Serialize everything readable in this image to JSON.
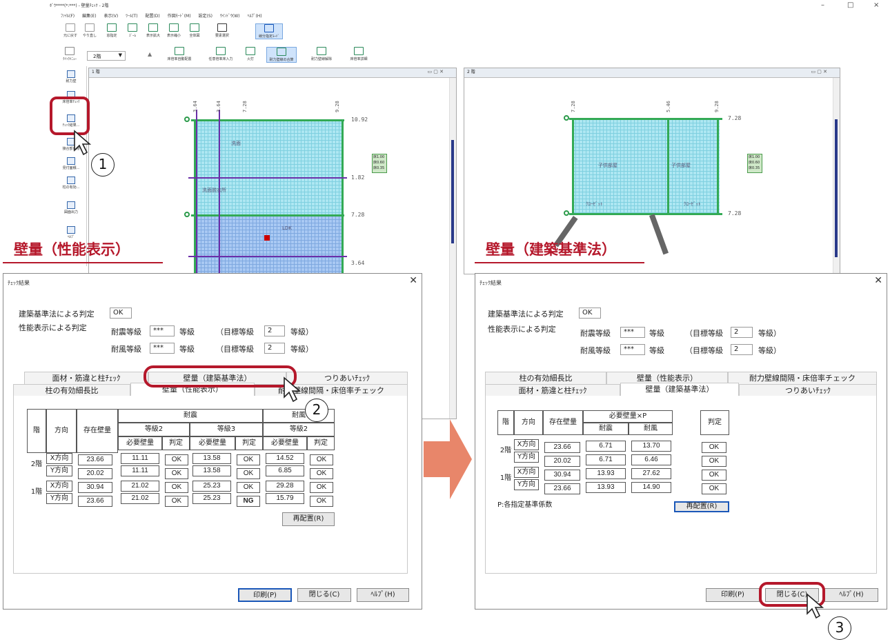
{
  "app": {
    "title": "ﾎﾞｳ****(*:***) - 壁量ﾁｪｯｸ - 2階",
    "menu": [
      "ﾌｧｲﾙ(F)",
      "編集(E)",
      "表示(V)",
      "ﾂｰﾙ(T)",
      "配置(D)",
      "作図ﾓｰﾄﾞ(M)",
      "設定(S)",
      "ｳｲﾝﾄﾞｳ(W)",
      "ﾍﾙﾌﾟ(H)"
    ],
    "toolbar": [
      "元に戻す",
      "やり直し",
      "窓指定",
      "ｽﾞｰﾑ",
      "表示拡大",
      "表示縮小",
      "全体図",
      "要素選択",
      "線分指定ﾓｰﾄﾞ"
    ],
    "toolbar2": [
      "床倍率自動配置",
      "任意倍率床入力",
      "火打",
      "耐力壁線の合算",
      "耐力壁線解除",
      "床倍率詳細"
    ],
    "floor_select": "2階",
    "quick_menu": "ｸｲｯｸﾒﾆｭｰ",
    "sidebar": [
      "耐力壁",
      "床倍率ﾁｪｯｸ",
      "ﾁｪｯｸ結果...",
      "接合部金物",
      "見付面積...",
      "柱の有効...",
      "図面出力",
      "ﾍﾙﾌﾟ"
    ],
    "window_controls": [
      "–",
      "□",
      "×"
    ]
  },
  "left_pane": {
    "title": "1 階",
    "top_dims": [
      "3.64",
      "3.64",
      "7.28",
      "9.28"
    ],
    "right_dims": [
      "10.92",
      "1.82",
      "7.28",
      "3.64"
    ],
    "rooms": [
      "洗面",
      "洗面脱衣所",
      "LDK"
    ],
    "legend": [
      "床1.00",
      "床0.60",
      "床0.35"
    ]
  },
  "right_pane": {
    "title": "2 階",
    "top_dims": [
      "7.28",
      "5.46",
      "9.28"
    ],
    "right_dims": [
      "7.28",
      "7.28"
    ],
    "rooms": [
      "子供部屋",
      "子供部屋",
      "ｸﾛｰｾﾞｯﾄ",
      "ｸﾛｰｾﾞｯﾄ"
    ],
    "legend": [
      "床1.00",
      "床0.60",
      "床0.35"
    ]
  },
  "sections": {
    "left": "壁量（性能表示）",
    "right": "壁量（建築基準法）"
  },
  "dialog_left": {
    "title": "ﾁｪｯｸ結果",
    "kijun_label": "建築基準法による判定",
    "kijun_value": "OK",
    "seino_label": "性能表示による判定",
    "taishin_label": "耐震等級",
    "taishin_value": "***",
    "taifu_label": "耐風等級",
    "taifu_value": "***",
    "tokyu": "等級",
    "mokuhyo_open": "（目標等級",
    "mokuhyo_close": "等級）",
    "mokuhyo_taishin": "2",
    "mokuhyo_taifu": "2",
    "tabs_back": [
      "面材・筋違と柱ﾁｪｯｸ",
      "壁量（建築基準法）",
      "つりあいﾁｪｯｸ"
    ],
    "tabs_front": [
      "柱の有効細長比",
      "壁量（性能表示）",
      "耐力壁線間隔・床倍率チェック"
    ],
    "table": {
      "h_kai": "階",
      "h_houko": "方向",
      "h_sonzai": "存在壁量",
      "h_taishin": "耐震",
      "h_taifu": "耐風",
      "h_tokyu2": "等級2",
      "h_tokyu3": "等級3",
      "h_tokyu2b": "等級2",
      "h_hitsuyo": "必要壁量",
      "h_hantei": "判定",
      "rows": [
        {
          "floor": "2階",
          "dir": "X方向",
          "exist": "23.66",
          "r2": "11.11",
          "j2": "OK",
          "r3": "13.58",
          "j3": "OK",
          "rw": "14.52",
          "jw": "OK"
        },
        {
          "floor": "",
          "dir": "Y方向",
          "exist": "20.02",
          "r2": "11.11",
          "j2": "OK",
          "r3": "13.58",
          "j3": "OK",
          "rw": "6.85",
          "jw": "OK"
        },
        {
          "floor": "1階",
          "dir": "X方向",
          "exist": "30.94",
          "r2": "21.02",
          "j2": "OK",
          "r3": "25.23",
          "j3": "OK",
          "rw": "29.28",
          "jw": "OK"
        },
        {
          "floor": "",
          "dir": "Y方向",
          "exist": "23.66",
          "r2": "21.02",
          "j2": "OK",
          "r3": "25.23",
          "j3": "NG",
          "rw": "15.79",
          "jw": "OK"
        }
      ]
    },
    "btn_rearrange": "再配置(R)",
    "btn_print": "印刷(P)",
    "btn_close": "閉じる(C)",
    "btn_help": "ﾍﾙﾌﾟ(H)"
  },
  "dialog_right": {
    "title": "ﾁｪｯｸ結果",
    "kijun_label": "建築基準法による判定",
    "kijun_value": "OK",
    "seino_label": "性能表示による判定",
    "taishin_label": "耐震等級",
    "taishin_value": "***",
    "taifu_label": "耐風等級",
    "taifu_value": "***",
    "tokyu": "等級",
    "mokuhyo_open": "（目標等級",
    "mokuhyo_close": "等級）",
    "mokuhyo_taishin": "2",
    "mokuhyo_taifu": "2",
    "tabs_back": [
      "柱の有効細長比",
      "壁量（性能表示）",
      "耐力壁線間隔・床倍率チェック"
    ],
    "tabs_front": [
      "面材・筋違と柱ﾁｪｯｸ",
      "壁量（建築基準法）",
      "つりあいﾁｪｯｸ"
    ],
    "table": {
      "h_kai": "階",
      "h_houko": "方向",
      "h_sonzai": "存在壁量",
      "h_hitsuyo_p": "必要壁量×P",
      "h_taishin": "耐震",
      "h_taifu": "耐風",
      "h_hantei": "判定",
      "rows": [
        {
          "floor": "2階",
          "dir": "X方向",
          "exist": "23.66",
          "eq": "6.71",
          "wind": "13.70",
          "j": "OK"
        },
        {
          "floor": "",
          "dir": "Y方向",
          "exist": "20.02",
          "eq": "6.71",
          "wind": "6.46",
          "j": "OK"
        },
        {
          "floor": "1階",
          "dir": "X方向",
          "exist": "30.94",
          "eq": "13.93",
          "wind": "27.62",
          "j": "OK"
        },
        {
          "floor": "",
          "dir": "Y方向",
          "exist": "23.66",
          "eq": "13.93",
          "wind": "14.90",
          "j": "OK"
        }
      ]
    },
    "note": "P:各指定基準係数",
    "btn_rearrange": "再配置(R)",
    "btn_print": "印刷(P)",
    "btn_close": "閉じる(C)",
    "btn_help": "ﾍﾙﾌﾟ(H)"
  },
  "callouts": [
    "1",
    "2",
    "3"
  ],
  "colors": {
    "accent_red": "#b5182b",
    "arrow_orange": "#e8866a",
    "grid_cyan": "#aee7f2",
    "wall_green": "#33aa55"
  }
}
